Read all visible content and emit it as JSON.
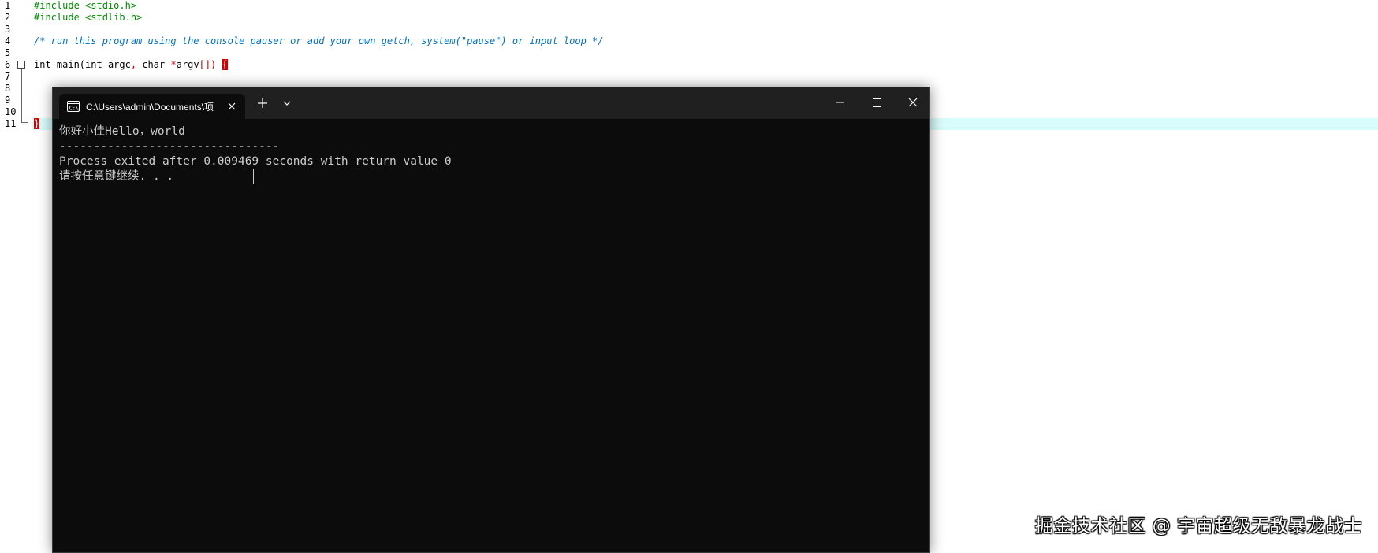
{
  "editor": {
    "line_numbers": [
      "1",
      "2",
      "3",
      "4",
      "5",
      "6",
      "7",
      "8",
      "9",
      "10",
      "11"
    ],
    "lines": {
      "l1": "#include <stdio.h>",
      "l2": "#include <stdlib.h>",
      "l4": "/* run this program using the console pauser or add your own getch, system(\"pause\") or input loop */",
      "l6_kw1": "int",
      "l6_name": " main(",
      "l6_kw2": "int",
      "l6_argc": " argc",
      "l6_comma": ",",
      "l6_char": " char ",
      "l6_star": "*",
      "l6_argv": "argv",
      "l6_brackets": "[])",
      "l6_open": "{",
      "l11_close": "}"
    },
    "fold_icon": "minus-box-icon"
  },
  "terminal": {
    "tab_title": "C:\\Users\\admin\\Documents\\项",
    "tab_icon": "console-icon",
    "output": [
      "你好小佳Hello，world",
      "--------------------------------",
      "Process exited after 0.009469 seconds with return value 0",
      "请按任意键继续. . ."
    ],
    "buttons": {
      "close_tab": "close-icon",
      "new_tab": "plus-icon",
      "dropdown": "chevron-down-icon",
      "minimize": "minimize-icon",
      "maximize": "maximize-icon",
      "close_window": "close-icon"
    },
    "background": "#0c0c0c",
    "titlebar_color": "#202020"
  },
  "watermark": "掘金技术社区 @ 宇宙超级无敌暴龙战士"
}
